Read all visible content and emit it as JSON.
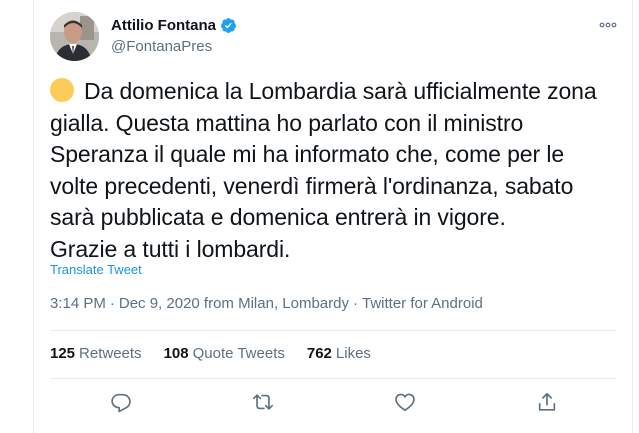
{
  "author": {
    "display_name": "Attilio Fontana",
    "handle": "@FontanaPres",
    "verified": true
  },
  "tweet": {
    "emoji_icon": "yellow-circle-icon",
    "lines": [
      "Da domenica la Lombardia sarà ufficialmente zona",
      "gialla. Questa mattina ho parlato con il ministro",
      "Speranza il quale mi ha informato che, come per le",
      "volte precedenti, venerdì firmerà l'ordinanza, sabato",
      "sarà pubblicata e domenica entrerà in vigore.",
      "Grazie a tutti i lombardi."
    ],
    "translate_label": "Translate Tweet"
  },
  "meta": {
    "time": "3:14 PM",
    "date": "Dec 9, 2020 from Milan, Lombardy",
    "source": "Twitter for Android",
    "separator": "·"
  },
  "stats": {
    "retweets_count": "125",
    "retweets_label": "Retweets",
    "quotes_count": "108",
    "quotes_label": "Quote Tweets",
    "likes_count": "762",
    "likes_label": "Likes"
  },
  "colors": {
    "accent": "#1b95e0",
    "verified": "#1da1f2",
    "secondary_text": "#5b7083",
    "emoji_yellow": "#fdcb58"
  },
  "icons": {
    "more": "more-dots-icon",
    "reply": "reply-icon",
    "retweet": "retweet-icon",
    "like": "heart-icon",
    "share": "share-icon"
  }
}
